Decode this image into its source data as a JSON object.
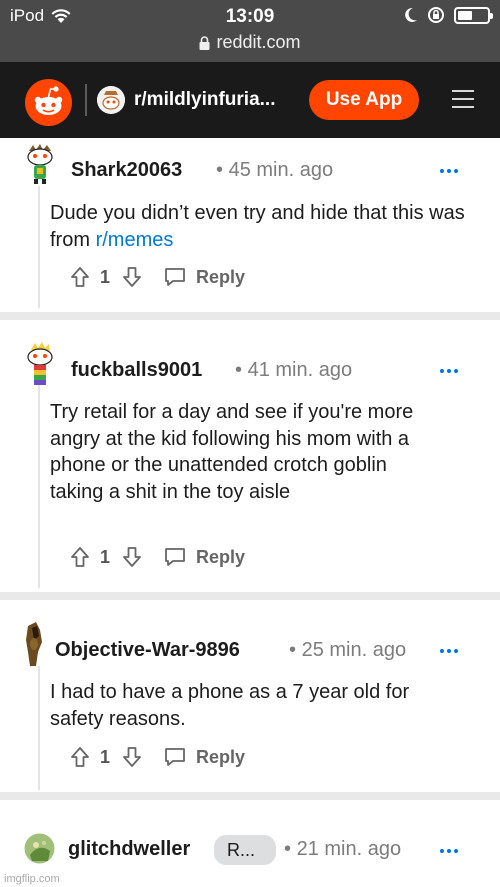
{
  "status_bar": {
    "carrier": "iPod",
    "time": "13:09",
    "url": "reddit.com"
  },
  "header": {
    "subreddit": "r/mildlyinfuria...",
    "use_app_label": "Use App",
    "brand_color": "#ff4500",
    "background": "#1a1a1b"
  },
  "comments": [
    {
      "author": "Shark20063",
      "time": "45 min. ago",
      "body_before_link": "Dude you didn’t even try and hide that this was from ",
      "link_text": "r/memes",
      "votes": "1",
      "reply_label": "Reply"
    },
    {
      "author": "fuckballs9001",
      "time": "41 min. ago",
      "body": "Try retail for a day and see if you're more angry at the kid following his mom with a phone or the unattended crotch goblin taking a shit in the toy aisle",
      "votes": "1",
      "reply_label": "Reply"
    },
    {
      "author": "Objective-War-9896",
      "time": "25 min. ago",
      "body": "I had to have a phone as a 7 year old for safety reasons.",
      "votes": "1",
      "reply_label": "Reply"
    },
    {
      "author": "glitchdweller",
      "flair": "R...",
      "time": "21 min. ago"
    }
  ],
  "meta_separator": "•",
  "link_color": "#0079d3",
  "watermark": "imgflip.com"
}
